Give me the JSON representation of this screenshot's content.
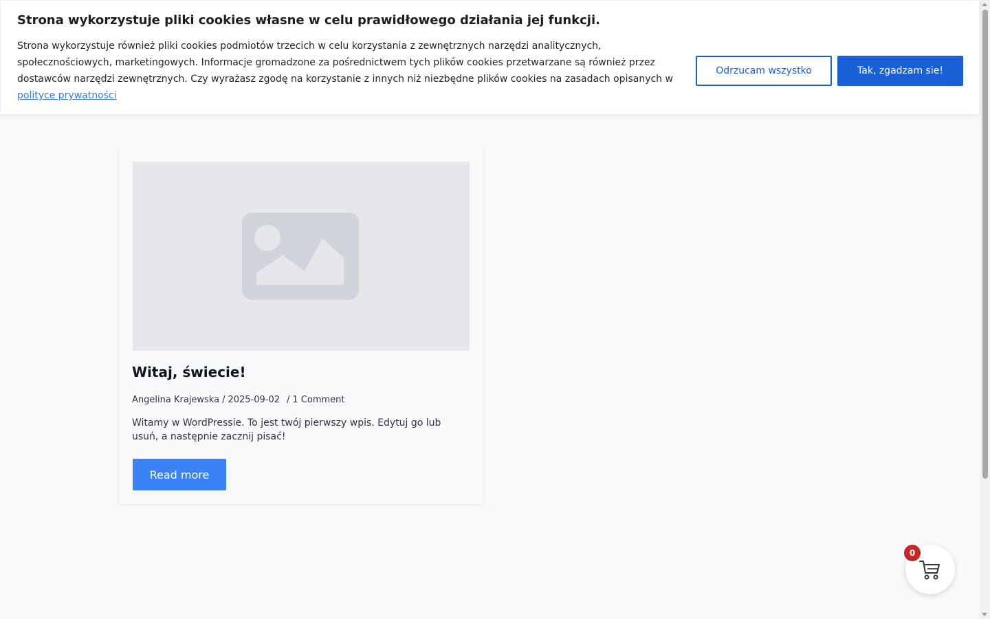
{
  "cookie_banner": {
    "title": "Strona wykorzystuje pliki cookies własne w celu prawidłowego działania jej funkcji.",
    "text": "Strona wykorzystuje również pliki cookies podmiotów trzecich w celu korzystania z zewnętrznych narzędzi analitycznych, społecznościowych, marketingowych. Informacje gromadzone za pośrednictwem tych plików cookies przetwarzane są również przez dostawców narzędzi zewnętrznych. Czy wyrażasz zgodę na korzystanie z innych niż niezbędne plików cookies na zasadach opisanych w ",
    "privacy_link": "polityce prywatności",
    "reject_label": "Odrzucam wszystko",
    "accept_label": "Tak, zgadzam sie!",
    "colors": {
      "primary": "#1a5fd6",
      "link": "#3b78d6"
    }
  },
  "post": {
    "thumbnail_icon": "image-placeholder-icon",
    "title": "Witaj, świecie!",
    "author": "Angelina Krajewska",
    "separator": "/",
    "date": "2025-09-02",
    "comments": "1 Comment",
    "excerpt": "Witamy w WordPressie. To jest twój pierwszy wpis. Edytuj go lub usuń, a następnie zacznij pisać!",
    "read_more_label": "Read more",
    "colors": {
      "button": "#3b82f6"
    }
  },
  "cart": {
    "icon": "shopping-cart-icon",
    "count": "0",
    "colors": {
      "badge": "#c62828"
    }
  }
}
